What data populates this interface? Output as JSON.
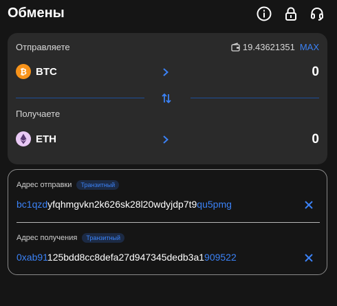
{
  "header": {
    "title": "Обмены",
    "icons": [
      "info-icon",
      "lock-icon",
      "headset-icon"
    ]
  },
  "swap": {
    "send": {
      "label": "Отправляете",
      "balance": "19.43621351",
      "max_label": "MAX",
      "coin": "BTC",
      "amount": "0"
    },
    "receive": {
      "label": "Получаете",
      "coin": "ETH",
      "amount": "0"
    }
  },
  "addresses": {
    "send": {
      "label": "Адрес отправки",
      "badge": "Транзитный",
      "prefix": "bc1qzd",
      "middle": "yfqhmgvkn2k626sk28l20wdyjdp7t9",
      "suffix": "qu5pmg"
    },
    "receive": {
      "label": "Адрес получения",
      "badge": "Транзитный",
      "prefix": "0xab91",
      "middle": "125bdd8cc8defa27d947345dedb3a1",
      "suffix": "909522"
    }
  },
  "colors": {
    "accent": "#3b82f6",
    "card": "#2a2a2a",
    "background": "#151515",
    "btc": "#f7931a",
    "eth_bg": "#e9c9f5"
  }
}
